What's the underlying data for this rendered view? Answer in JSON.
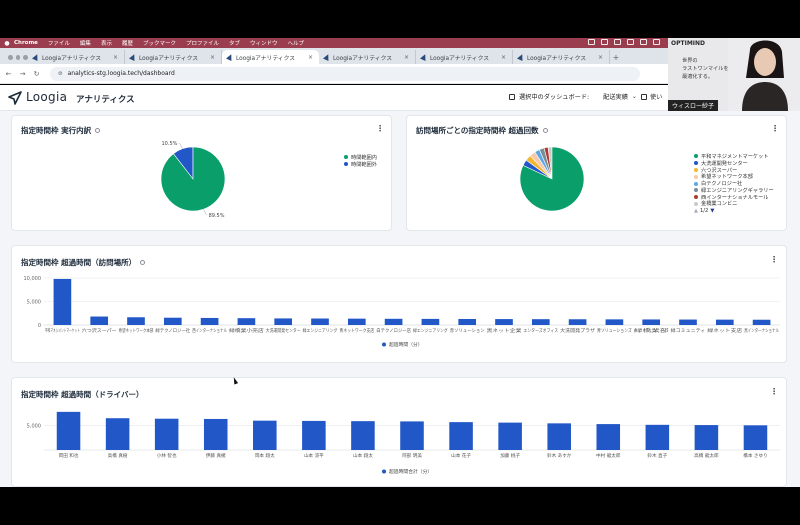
{
  "os_menu": {
    "items": [
      "Chrome",
      "ファイル",
      "編集",
      "表示",
      "履歴",
      "ブックマーク",
      "プロファイル",
      "タブ",
      "ウィンドウ",
      "ヘルプ"
    ]
  },
  "browser": {
    "tabs": [
      {
        "label": "Loogiaアナリティクス",
        "active": false
      },
      {
        "label": "Loogiaアナリティクス",
        "active": false
      },
      {
        "label": "Loogiaアナリティクス",
        "active": true
      },
      {
        "label": "Loogiaアナリティクス",
        "active": false
      },
      {
        "label": "Loogiaアナリティクス",
        "active": false
      },
      {
        "label": "Loogiaアナリティクス",
        "active": false
      }
    ],
    "url": "analytics-stg.loogia.tech/dashboard"
  },
  "app": {
    "brand": "Loogia",
    "brand_sub": "アナリティクス",
    "dashboard_label": "選択中のダッシュボード:",
    "dashboard_value": "配送実績",
    "usage_label": "使い"
  },
  "cards": {
    "pie1": {
      "title": "指定時間枠 実行内訳"
    },
    "pie2": {
      "title": "訪問場所ごとの指定時間枠 超過回数",
      "pager": "1/2"
    },
    "bar1": {
      "title": "指定時間枠 超過時間（訪問場所）"
    },
    "bar2": {
      "title": "指定時間枠 超過時間（ドライバー）"
    }
  },
  "webcam": {
    "corp": "OPTIMIND",
    "slogan": [
      "世界の",
      "ラストワンマイルを",
      "最適化する。"
    ],
    "name": "ウィスロー紗子"
  },
  "colors": {
    "green": "#0a9f6a",
    "blue": "#2257c7",
    "bar": "#2257c7"
  },
  "chart_data": [
    {
      "type": "pie",
      "title": "指定時間枠 実行内訳",
      "categories": [
        "時間範囲内",
        "時間範囲外"
      ],
      "values": [
        89.5,
        10.5
      ],
      "labels": [
        "89.5%",
        "10.5%"
      ],
      "colors": [
        "#0a9f6a",
        "#2257c7"
      ],
      "legend": "right"
    },
    {
      "type": "pie",
      "title": "訪問場所ごとの指定時間枠 超過回数",
      "categories": [
        "平和マネジメントマーケット",
        "大洗運開発センター",
        "六つ沢スーパー",
        "希望ネットワーク本部",
        "白テクノロジー社",
        "緑エンジニアリングギャラリー",
        "西インターナショナルモール",
        "金橋業コンビニ"
      ],
      "values": [
        82,
        3,
        3,
        3,
        2.5,
        2.5,
        2,
        2
      ],
      "colors": [
        "#0a9f6a",
        "#2257c7",
        "#f2b632",
        "#f7c9a8",
        "#5ba8e8",
        "#7a8e99",
        "#b03a2e",
        "#c9c9c9"
      ],
      "legend": "right"
    },
    {
      "type": "bar",
      "title": "指定時間枠 超過時間（訪問場所）",
      "categories": [
        "平和マネジメントマーケット",
        "六つ沢スーパー",
        "希望ネットワーク本部",
        "緑テクノロジー社",
        "西インターナショナル",
        "緑橋業小売店",
        "大洗運開発センター",
        "緑エンジニアリング",
        "青ネットワーク支店",
        "白テクノロジー店",
        "緑エンジニアリング",
        "赤ソリューション",
        "黒ネット企業",
        "エンターズオフィス",
        "大洗開発プラザ",
        "青ソリューションズ",
        "緑橋業部",
        "緑コミュニティ",
        "緑ネット支店",
        "黒インターナショナル"
      ],
      "values": [
        9800,
        1800,
        1650,
        1550,
        1500,
        1450,
        1400,
        1380,
        1350,
        1320,
        1300,
        1280,
        1260,
        1240,
        1220,
        1200,
        1180,
        1160,
        1140,
        1120
      ],
      "ylim": [
        0,
        10000
      ],
      "yticks": [
        0,
        5000,
        10000
      ],
      "ytick_labels": [
        "0",
        "5,000",
        "10,000"
      ],
      "legend": "超過時間（分）"
    },
    {
      "type": "bar",
      "title": "指定時間枠 超過時間（ドライバー）",
      "categories": [
        "岡田 和也",
        "高橋 真樹",
        "小林 智也",
        "伊藤 真緒",
        "岡本 翔太",
        "山本 涼平",
        "山本 翔太",
        "阿部 明美",
        "山本 花子",
        "加藤 桃子",
        "鈴木 あすか",
        "中村 龍太郎",
        "鈴木 直子",
        "高橋 龍太郎",
        "橋本 さゆり"
      ],
      "values": [
        7800,
        6500,
        6400,
        6350,
        6000,
        5950,
        5900,
        5850,
        5700,
        5600,
        5450,
        5300,
        5150,
        5100,
        5050
      ],
      "ylim": [
        0,
        9000
      ],
      "yticks": [
        5000
      ],
      "ytick_labels": [
        "5,000"
      ],
      "legend": "超過時間合計（分）"
    }
  ]
}
